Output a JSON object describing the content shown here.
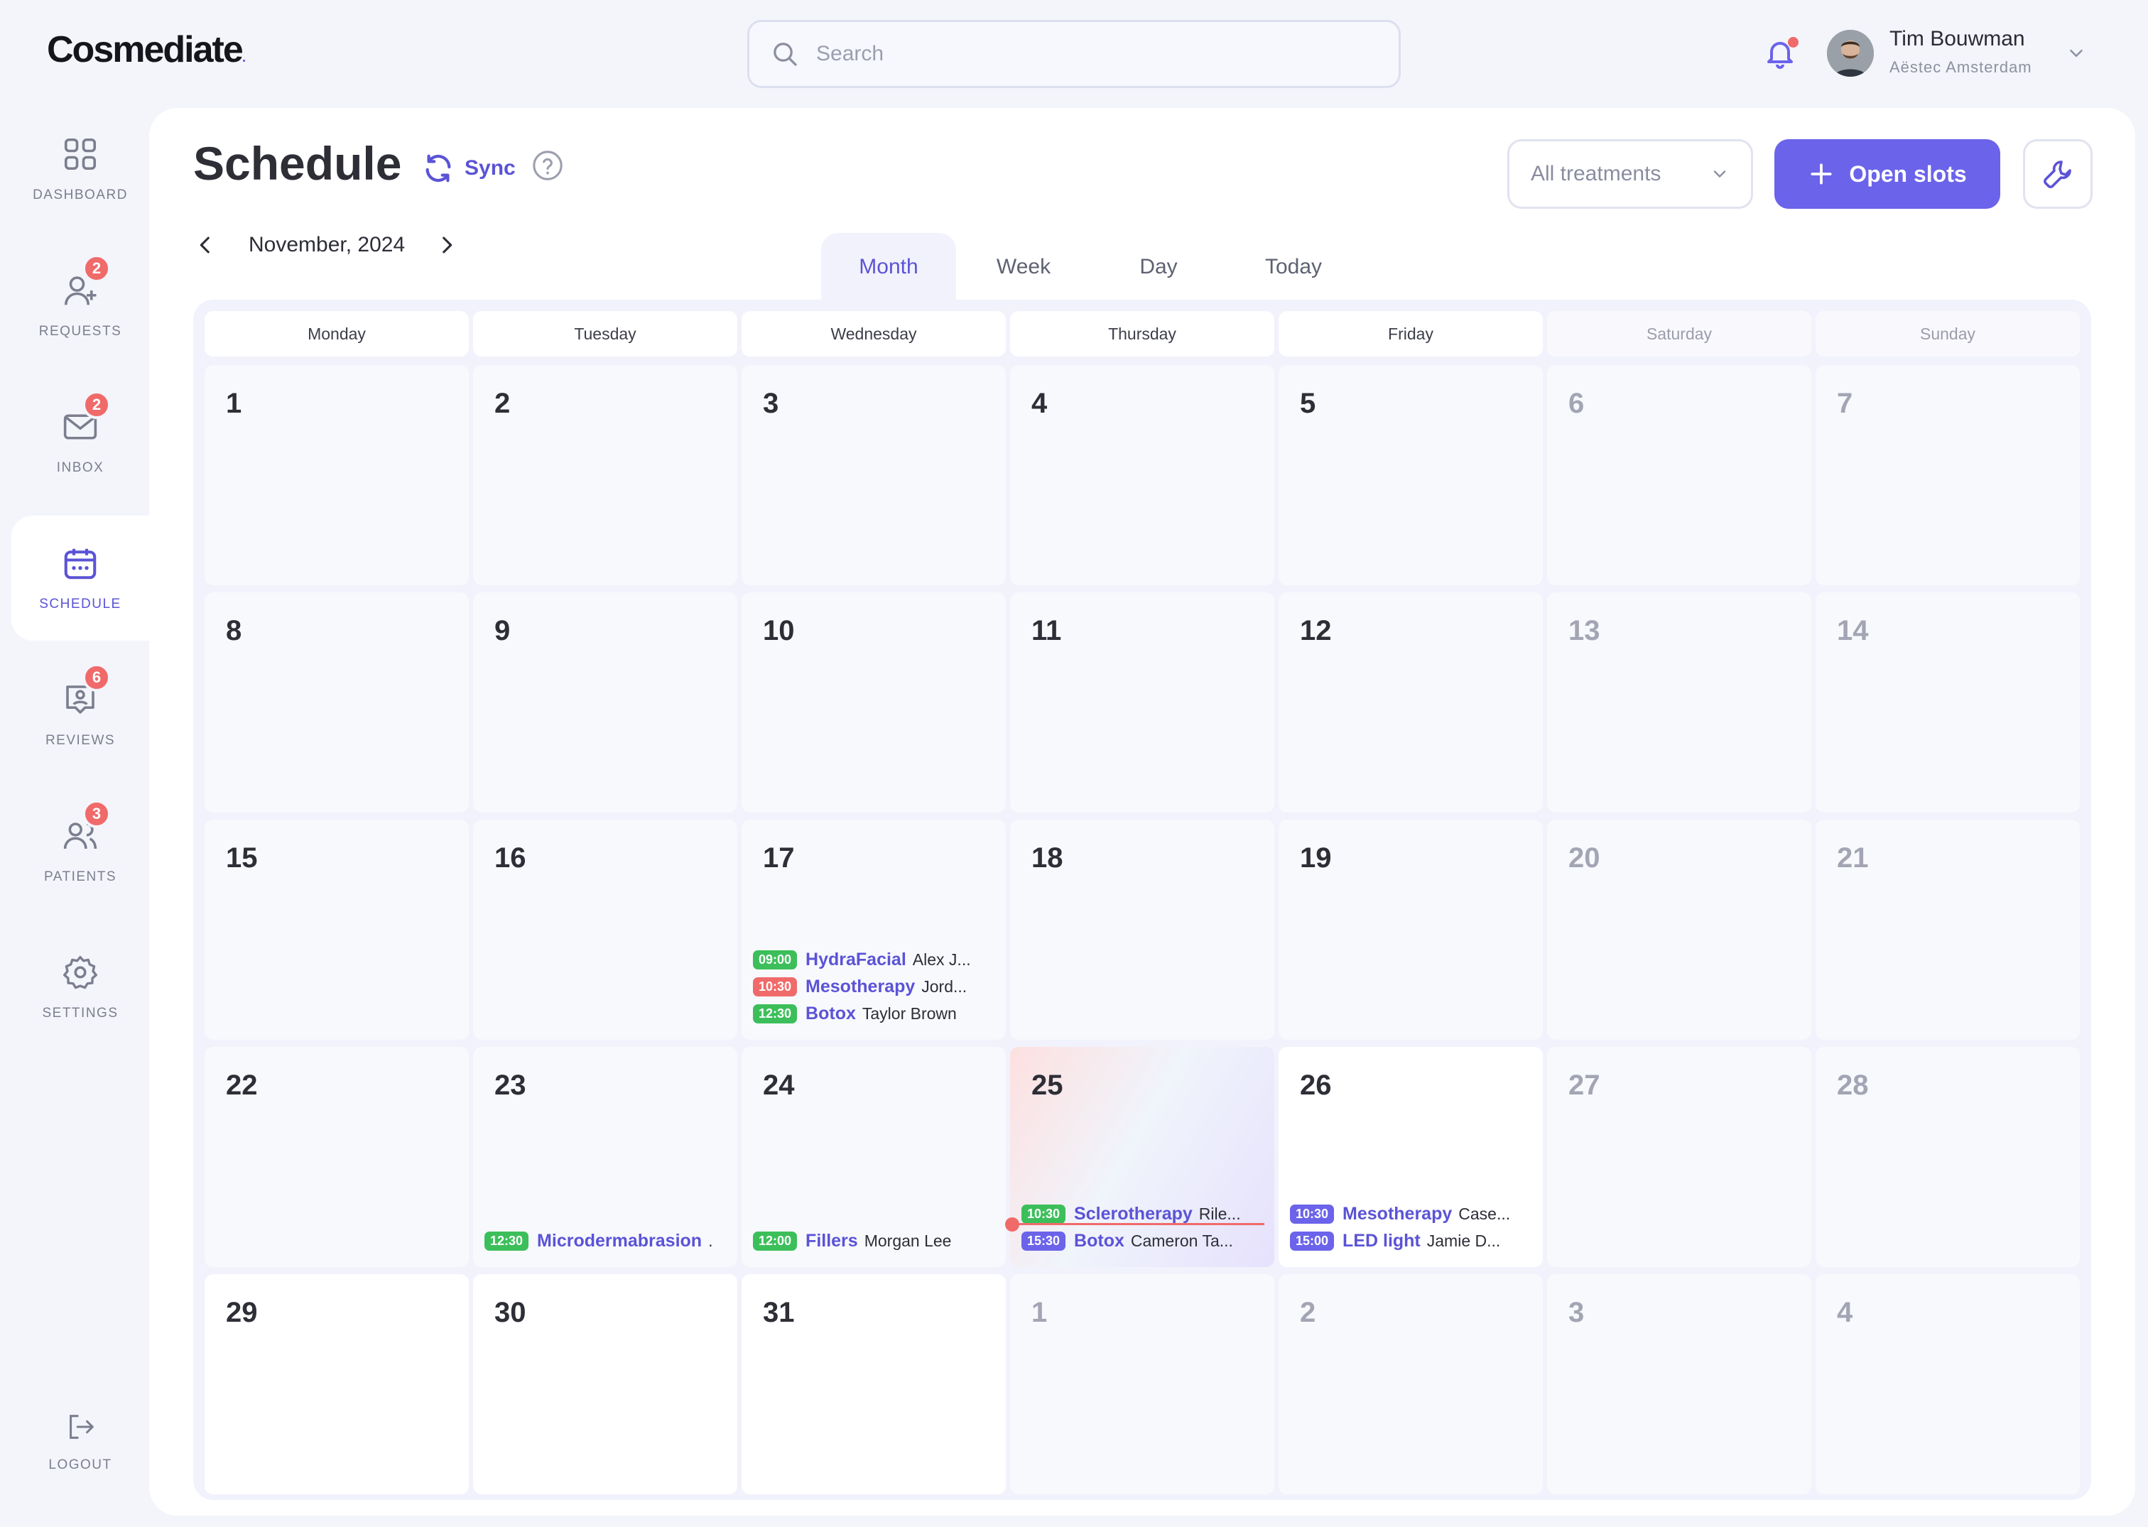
{
  "brand": {
    "name": "Cosmediate",
    "dot": "."
  },
  "search": {
    "placeholder": "Search"
  },
  "user": {
    "name": "Tim Bouwman",
    "org": "Aëstec Amsterdam"
  },
  "colors": {
    "accent": "#6b63ea",
    "danger": "#f06a6a",
    "success": "#3cbf5a",
    "muted": "#a3a5b4"
  },
  "sidebar": {
    "items": [
      {
        "id": "dashboard",
        "label": "DASHBOARD",
        "icon": "grid-icon",
        "badge": ""
      },
      {
        "id": "requests",
        "label": "REQUESTS",
        "icon": "user-plus-icon",
        "badge": "2"
      },
      {
        "id": "inbox",
        "label": "INBOX",
        "icon": "mail-icon",
        "badge": "2"
      },
      {
        "id": "schedule",
        "label": "SCHEDULE",
        "icon": "calendar-icon",
        "badge": "",
        "active": true
      },
      {
        "id": "reviews",
        "label": "REVIEWS",
        "icon": "review-icon",
        "badge": "6"
      },
      {
        "id": "patients",
        "label": "PATIENTS",
        "icon": "users-icon",
        "badge": "3"
      },
      {
        "id": "settings",
        "label": "SETTINGS",
        "icon": "gear-icon",
        "badge": ""
      }
    ],
    "logout": "LOGOUT"
  },
  "header": {
    "title": "Schedule",
    "sync_label": "Sync",
    "filter_label": "All treatments",
    "open_slots_label": "Open slots"
  },
  "calendar": {
    "month_label": "November, 2024",
    "tabs": [
      "Month",
      "Week",
      "Day",
      "Today"
    ],
    "active_tab": "Month",
    "weekdays": [
      "Monday",
      "Tuesday",
      "Wednesday",
      "Thursday",
      "Friday",
      "Saturday",
      "Sunday"
    ],
    "weeks": [
      [
        {
          "day": "1"
        },
        {
          "day": "2"
        },
        {
          "day": "3"
        },
        {
          "day": "4"
        },
        {
          "day": "5"
        },
        {
          "day": "6",
          "muted": true
        },
        {
          "day": "7",
          "muted": true
        }
      ],
      [
        {
          "day": "8"
        },
        {
          "day": "9"
        },
        {
          "day": "10"
        },
        {
          "day": "11"
        },
        {
          "day": "12"
        },
        {
          "day": "13",
          "muted": true
        },
        {
          "day": "14",
          "muted": true
        }
      ],
      [
        {
          "day": "15"
        },
        {
          "day": "16"
        },
        {
          "day": "17",
          "events": [
            {
              "time": "09:00",
              "treatment": "HydraFacial",
              "patient": "Alex J...",
              "status": "success"
            },
            {
              "time": "10:30",
              "treatment": "Mesotherapy",
              "patient": "Jord...",
              "status": "danger"
            },
            {
              "time": "12:30",
              "treatment": "Botox",
              "patient": "Taylor Brown",
              "status": "success"
            }
          ]
        },
        {
          "day": "18"
        },
        {
          "day": "19"
        },
        {
          "day": "20",
          "muted": true
        },
        {
          "day": "21",
          "muted": true
        }
      ],
      [
        {
          "day": "22"
        },
        {
          "day": "23",
          "events": [
            {
              "time": "12:30",
              "treatment": "Microdermabrasion",
              "patient": ".",
              "status": "success"
            }
          ]
        },
        {
          "day": "24",
          "events": [
            {
              "time": "12:00",
              "treatment": "Fillers",
              "patient": "Morgan Lee",
              "status": "success"
            }
          ]
        },
        {
          "day": "25",
          "today": true,
          "events": [
            {
              "time": "10:30",
              "treatment": "Sclerotherapy",
              "patient": "Rile...",
              "status": "success"
            },
            {
              "time": "15:30",
              "treatment": "Botox",
              "patient": "Cameron Ta...",
              "status": "accent"
            }
          ]
        },
        {
          "day": "26",
          "white": true,
          "events": [
            {
              "time": "10:30",
              "treatment": "Mesotherapy",
              "patient": "Case...",
              "status": "accent"
            },
            {
              "time": "15:00",
              "treatment": "LED light",
              "patient": "Jamie D...",
              "status": "accent"
            }
          ]
        },
        {
          "day": "27",
          "muted": true
        },
        {
          "day": "28",
          "muted": true
        }
      ],
      [
        {
          "day": "29",
          "white": true
        },
        {
          "day": "30",
          "white": true
        },
        {
          "day": "31",
          "white": true
        },
        {
          "day": "1",
          "muted": true
        },
        {
          "day": "2",
          "muted": true
        },
        {
          "day": "3",
          "muted": true
        },
        {
          "day": "4",
          "muted": true
        }
      ]
    ]
  }
}
